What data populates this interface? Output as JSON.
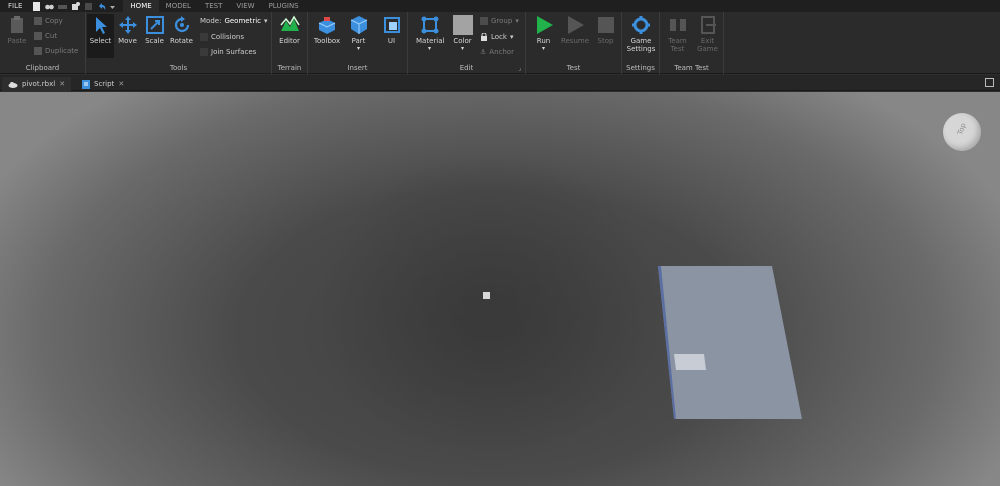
{
  "menubar": {
    "file": "FILE",
    "tabs": [
      "HOME",
      "MODEL",
      "TEST",
      "VIEW",
      "PLUGINS"
    ],
    "active_tab": "HOME"
  },
  "ribbon": {
    "clipboard": {
      "label": "Clipboard",
      "paste": "Paste",
      "copy": "Copy",
      "cut": "Cut",
      "duplicate": "Duplicate"
    },
    "tools": {
      "label": "Tools",
      "select": "Select",
      "move": "Move",
      "scale": "Scale",
      "rotate": "Rotate",
      "mode_label": "Mode:",
      "mode_value": "Geometric",
      "collisions": "Collisions",
      "join_surfaces": "Join Surfaces"
    },
    "terrain": {
      "label": "Terrain",
      "editor": "Editor"
    },
    "insert": {
      "label": "Insert",
      "toolbox": "Toolbox",
      "part": "Part",
      "ui": "UI"
    },
    "edit": {
      "label": "Edit",
      "material": "Material",
      "color": "Color",
      "group": "Group",
      "lock": "Lock",
      "anchor": "Anchor"
    },
    "test": {
      "label": "Test",
      "run": "Run",
      "resume": "Resume",
      "stop": "Stop"
    },
    "settings": {
      "label": "Settings",
      "game_settings_1": "Game",
      "game_settings_2": "Settings"
    },
    "team_test": {
      "label": "Team Test",
      "team_test_1": "Team",
      "team_test_2": "Test",
      "exit_game_1": "Exit",
      "exit_game_2": "Game"
    }
  },
  "tabs": {
    "doc1": "pivot.rbxl",
    "doc2": "Script"
  },
  "viewport": {
    "viewcube_label": "Top"
  },
  "colors": {
    "accent_blue": "#3b8fdd",
    "run_green": "#21b24c",
    "baseplate": "#8b94a3"
  }
}
